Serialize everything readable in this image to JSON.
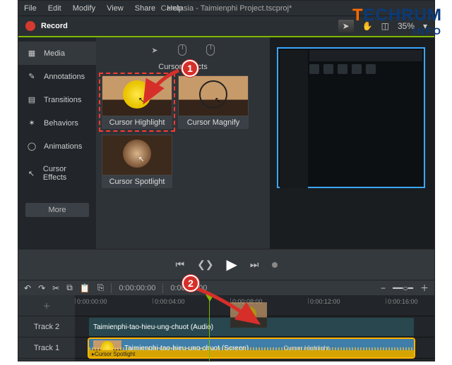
{
  "app": {
    "title": "Camtasia - Taimienphi Project.tscproj*"
  },
  "menu": [
    "File",
    "Edit",
    "Modify",
    "View",
    "Share",
    "Help"
  ],
  "record": {
    "label": "Record"
  },
  "toolbar": {
    "zoom": "35%"
  },
  "sidebar": {
    "items": [
      {
        "label": "Media",
        "icon": "media-icon"
      },
      {
        "label": "Annotations",
        "icon": "annotations-icon"
      },
      {
        "label": "Transitions",
        "icon": "transitions-icon"
      },
      {
        "label": "Behaviors",
        "icon": "behaviors-icon"
      },
      {
        "label": "Animations",
        "icon": "animations-icon"
      },
      {
        "label": "Cursor Effects",
        "icon": "cursor-effects-icon"
      }
    ],
    "more": "More"
  },
  "effects": {
    "section_title": "Cursor Effects",
    "items": [
      {
        "label": "Cursor Highlight"
      },
      {
        "label": "Cursor Magnify"
      },
      {
        "label": "Cursor Spotlight"
      }
    ]
  },
  "timecode": {
    "current": "0:00:00:00",
    "total": "0:00:00:00"
  },
  "timeline": {
    "ticks": [
      "0:00:00:00",
      "0:00:04:00",
      "0:00:08:00",
      "0:00:12:00",
      "0:00:16:00"
    ],
    "tracks": [
      {
        "name": "Track 2",
        "clip": "Taimienphi-tao-hieu-ung-chuot (Audio)"
      },
      {
        "name": "Track 1",
        "clip": "Taimienphi-tao-hieu-ung-chuot (Screen)",
        "mini_label": "Cursor Highlight",
        "effect": "Cursor Spotlight"
      }
    ]
  },
  "callouts": {
    "one": "1",
    "two": "2"
  },
  "watermark": {
    "brand1": "T",
    "brand2": "ECHRUM",
    "brand3": "INFO"
  }
}
